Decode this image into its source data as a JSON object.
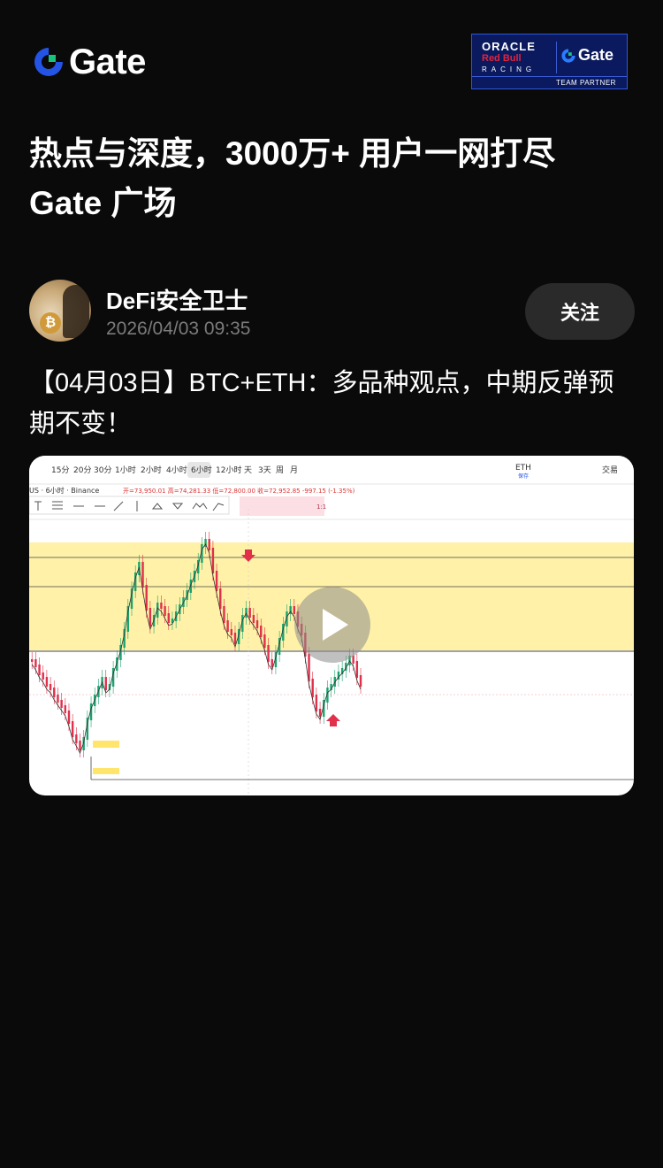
{
  "brand": {
    "logo_text": "Gate",
    "logo_icon": "gate-logo-icon",
    "accent": "#2354e6",
    "accent2": "#19c37d"
  },
  "partner_badge": {
    "oracle": "ORACLE",
    "redbull": "Red Bull",
    "racing": "RACING",
    "gate": "Gate",
    "team_partner": "TEAM PARTNER"
  },
  "headline": {
    "line1": "热点与深度，3000万+ 用户一网打尽",
    "line2": "Gate 广场"
  },
  "author": {
    "name": "DeFi安全卫士",
    "timestamp": "2026/04/03 09:35",
    "follow_label": "关注"
  },
  "post": {
    "text": "【04月03日】BTC+ETH：多品种观点，中期反弹预期不变！"
  },
  "video": {
    "toolbar": [
      "15分",
      "20分",
      "30分",
      "1小时",
      "2小时",
      "4小时",
      "6小时",
      "12小时",
      "天",
      "3天",
      "周",
      "月"
    ],
    "active_interval": "6小时",
    "symbol_label": "US · 6小时 · Binance",
    "ohlc": "开=73,950.01  高=74,281.33  低=72,800.00  收=72,952.85  -997.15 (-1.35%)",
    "eth_label": "ETH",
    "eth_sub": "保存",
    "trade_label": "交易",
    "ratio_label": "1:1",
    "play_icon": "play-icon"
  }
}
